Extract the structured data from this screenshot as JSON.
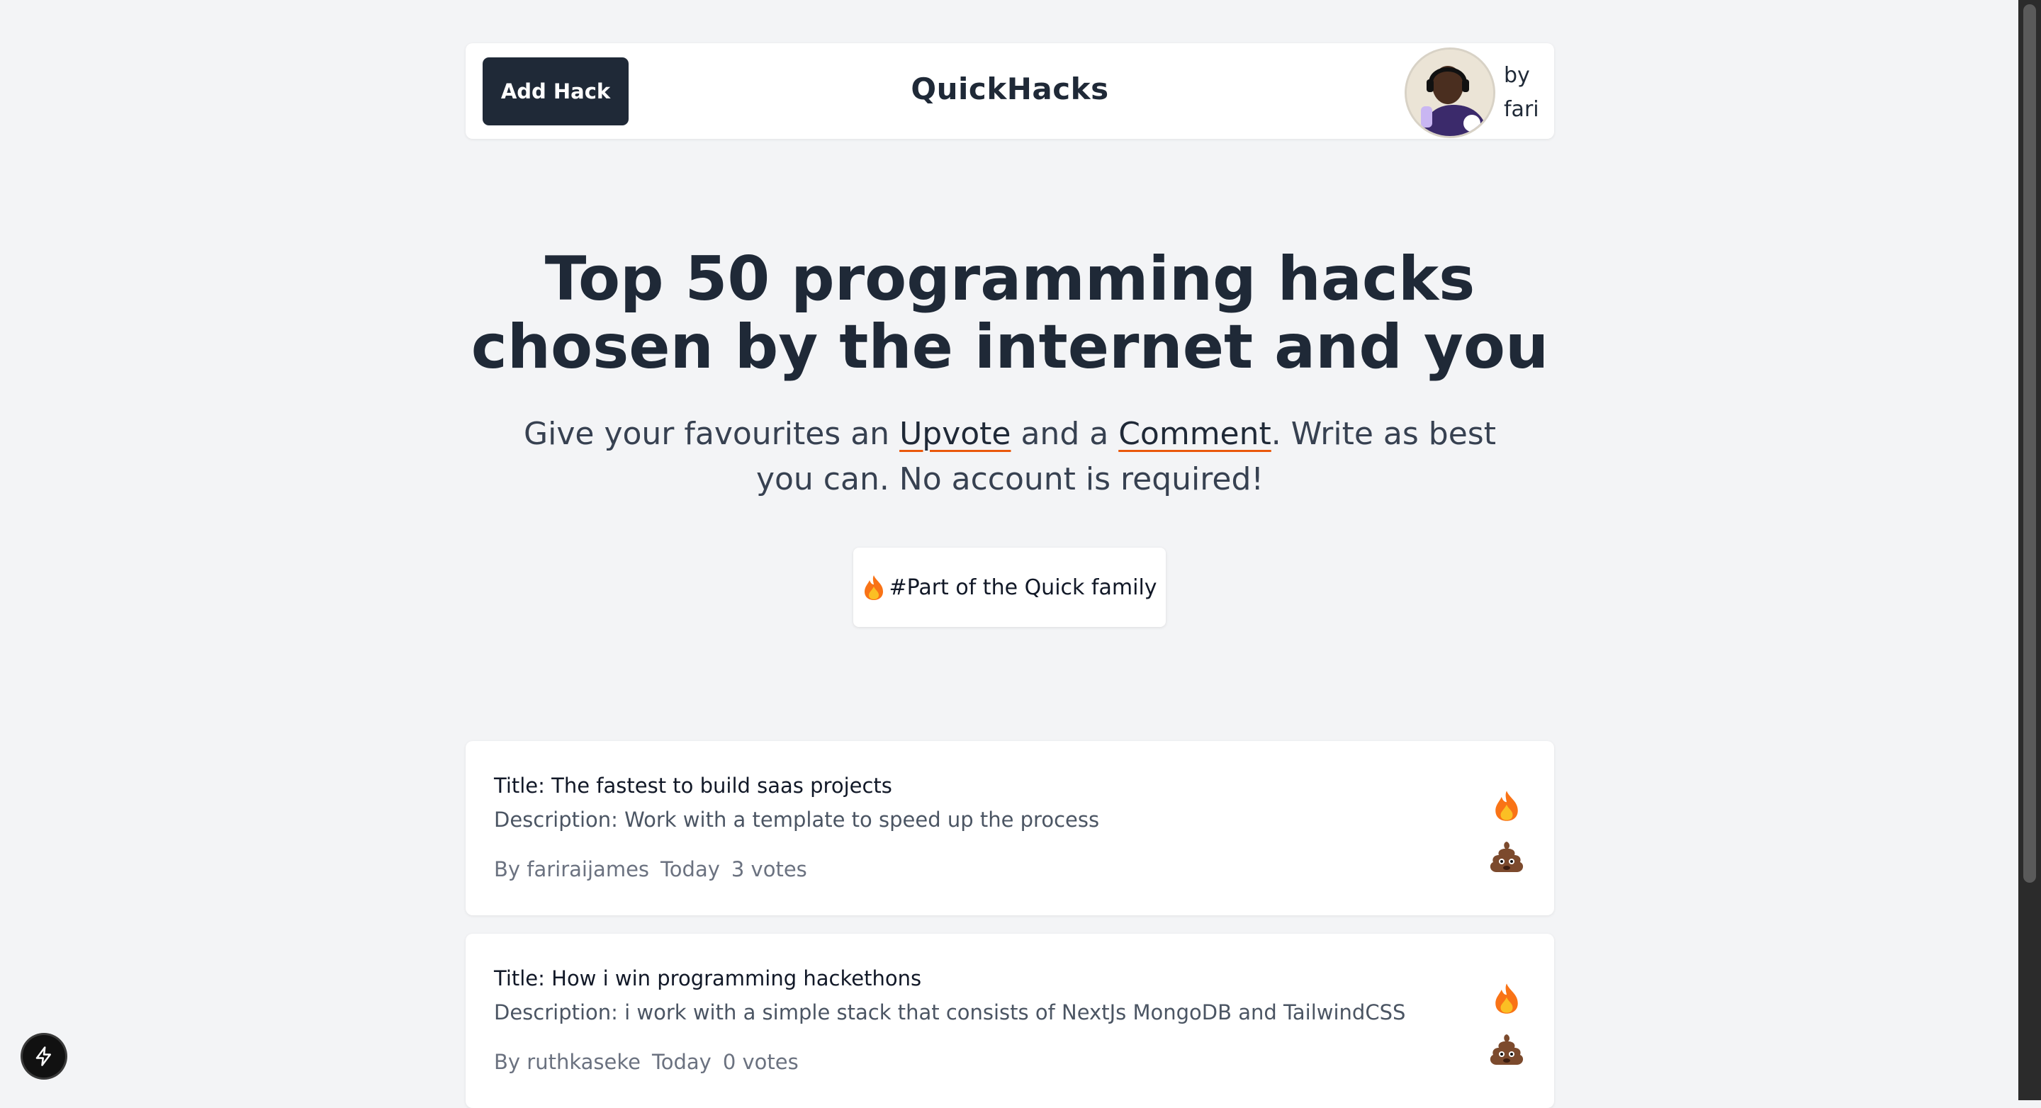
{
  "header": {
    "add_button": "Add Hack",
    "brand": "QuickHacks",
    "by_label": "by",
    "author": "fari"
  },
  "hero": {
    "title": "Top 50 programming hacks chosen by the internet and you",
    "sub_before": "Give your favourites an ",
    "upvote_link": "Upvote",
    "sub_middle": " and a ",
    "comment_link": "Comment",
    "sub_after": ". Write as best you can. No account is required!",
    "family_badge": "#Part of the Quick family"
  },
  "hacks": [
    {
      "title": "Title: The fastest to build saas projects",
      "description": "Description: Work with a template to speed up the process",
      "author": "By fariraijames",
      "date": "Today",
      "votes": "3 votes"
    },
    {
      "title": "Title: How i win programming hackethons",
      "description": "Description: i work with a simple stack that consists of NextJs MongoDB and TailwindCSS",
      "author": "By ruthkaseke",
      "date": "Today",
      "votes": "0 votes"
    }
  ],
  "icons": {
    "upvote": "fire-icon",
    "downvote": "poop-icon",
    "floating": "lightning-bolt-icon"
  },
  "colors": {
    "background": "#f3f4f6",
    "primary_button": "#1f2937",
    "link_underline": "#ea580c",
    "fire": "#f97316",
    "poop": "#7c4a2d"
  }
}
